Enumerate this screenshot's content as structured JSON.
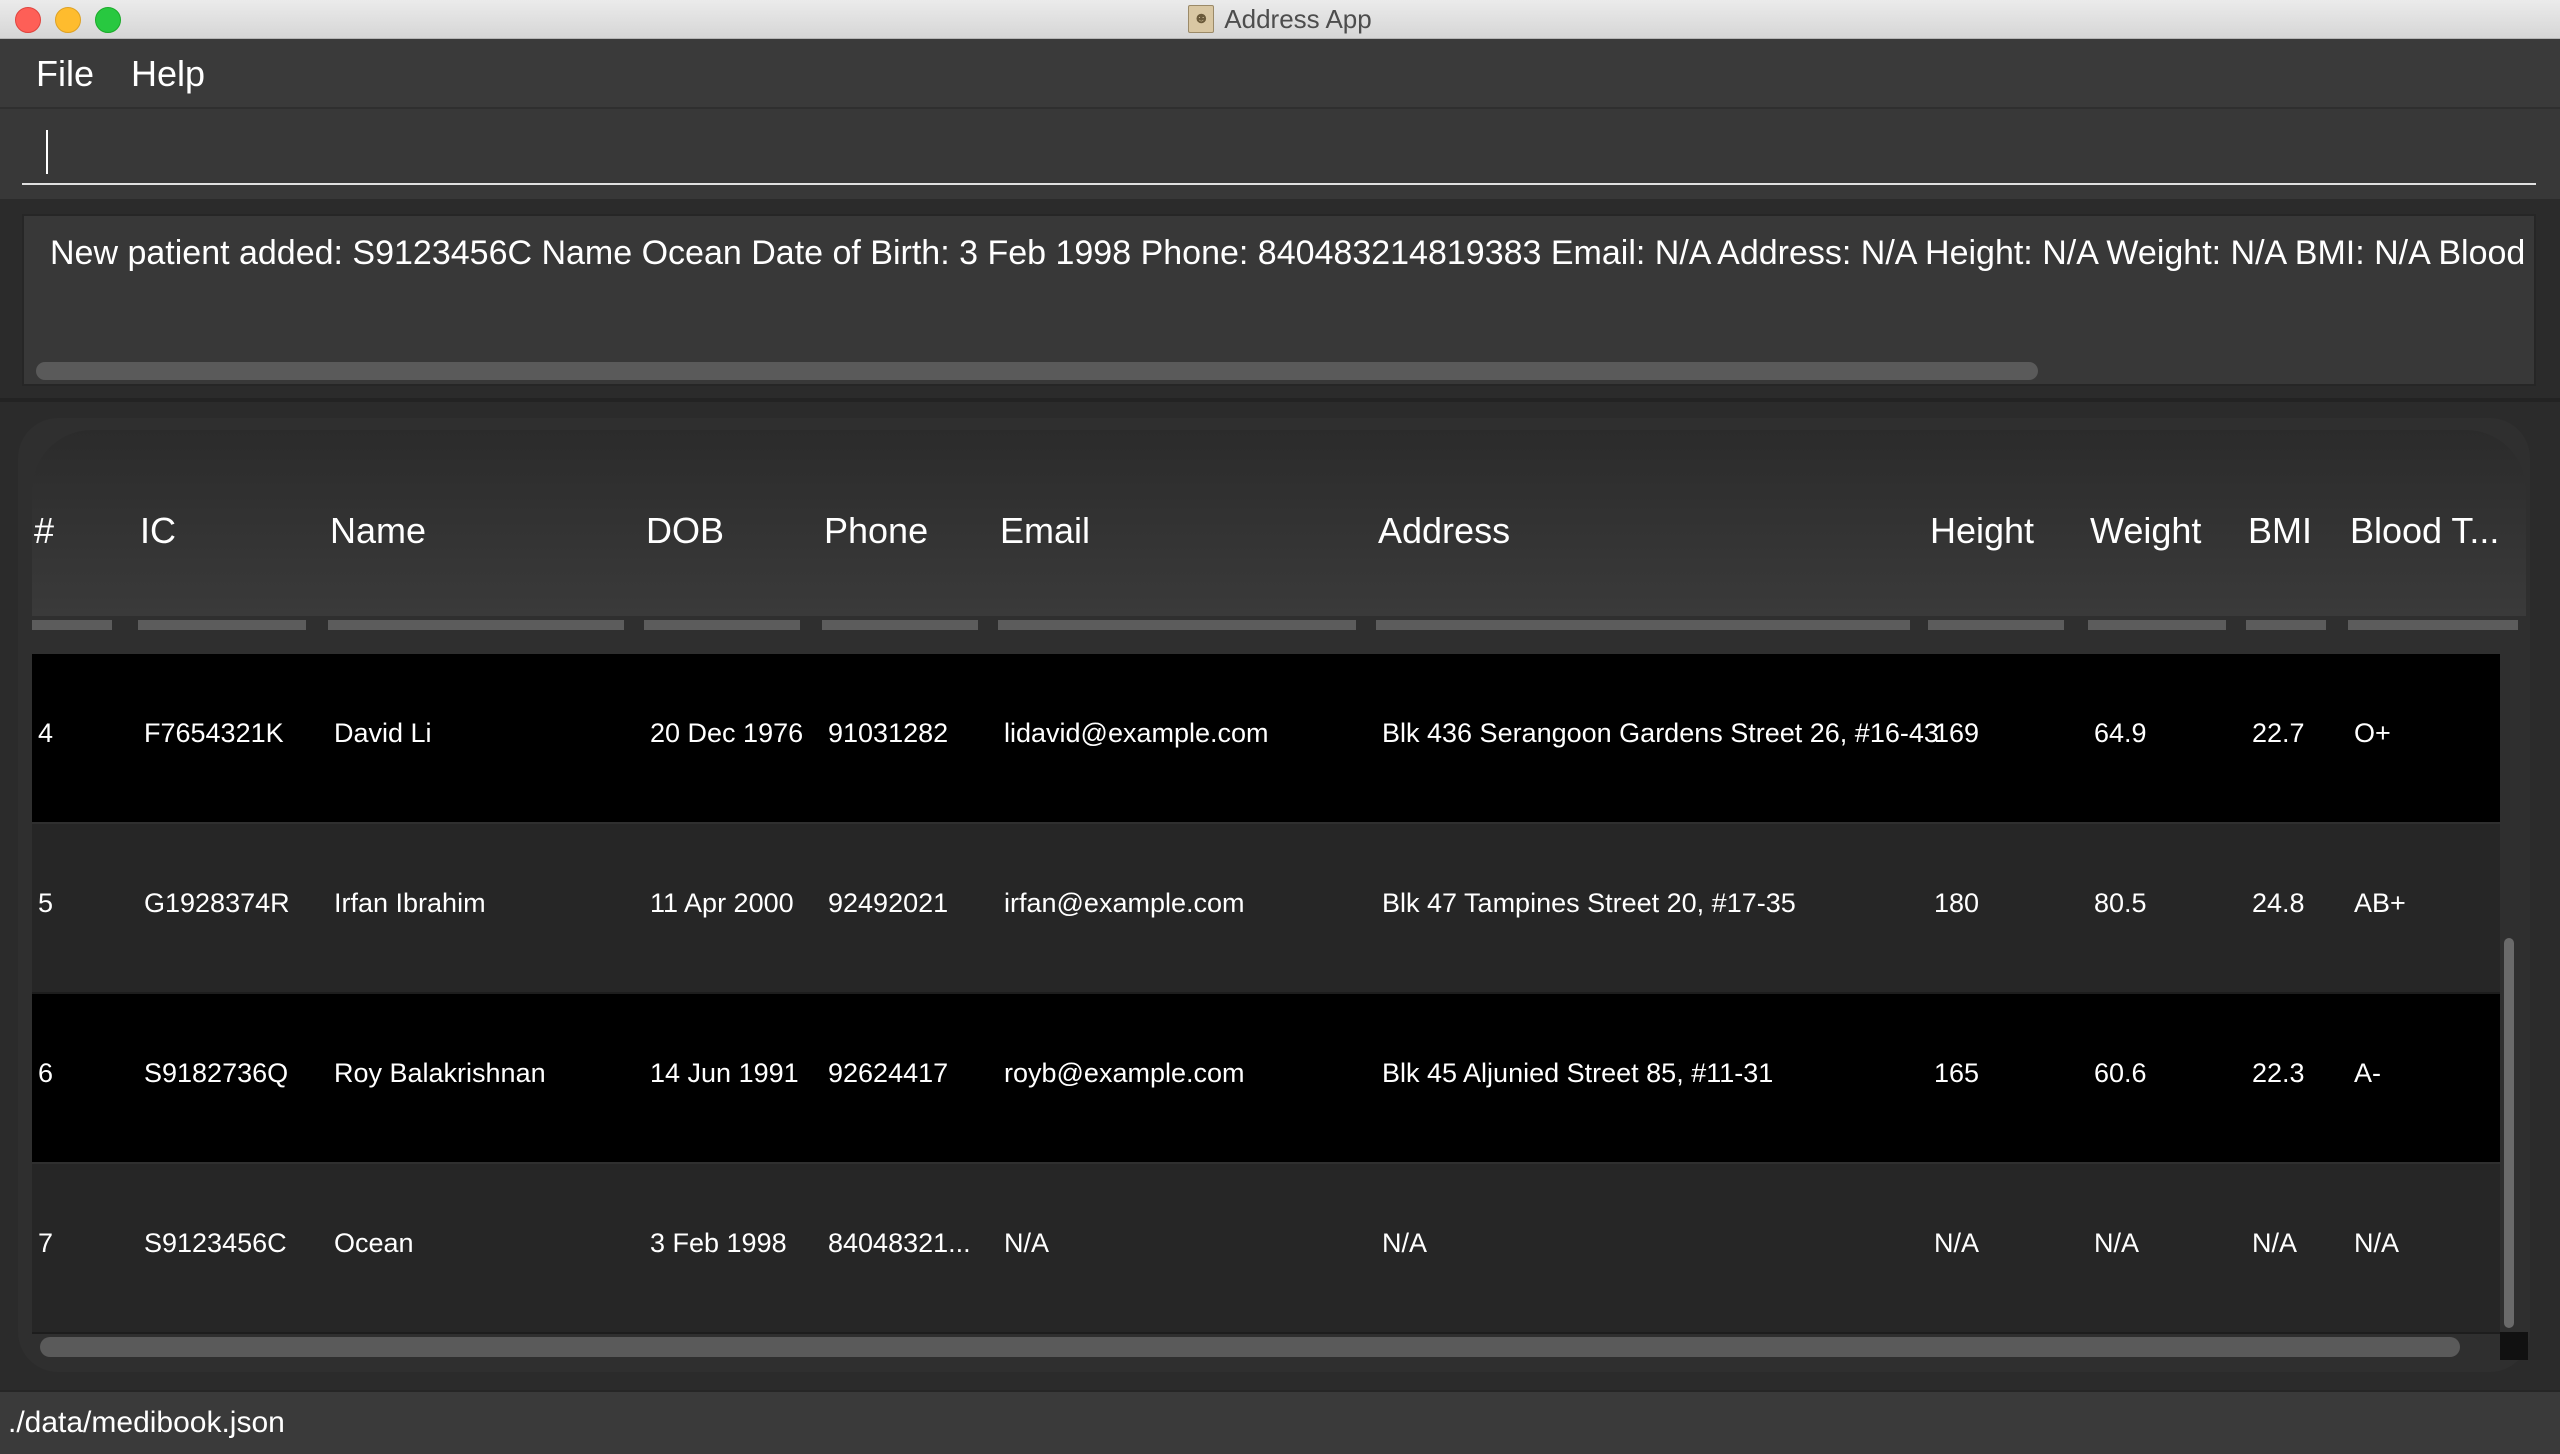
{
  "window": {
    "title": "Address App",
    "icon": "address-book-icon"
  },
  "menu": {
    "file": "File",
    "help": "Help"
  },
  "command": {
    "value": "",
    "placeholder": ""
  },
  "result": {
    "text": "New patient added: S9123456C Name Ocean Date of Birth: 3 Feb 1998 Phone: 840483214819383 Email: N/A Address: N/A Height: N/A Weight: N/A BMI: N/A Blood type:"
  },
  "table": {
    "columns": [
      "#",
      "IC",
      "Name",
      "DOB",
      "Phone",
      "Email",
      "Address",
      "Height",
      "Weight",
      "BMI",
      "Blood T..."
    ],
    "rows": [
      [
        "4",
        "F7654321K",
        "David Li",
        "20 Dec 1976",
        "91031282",
        "lidavid@example.com",
        "Blk 436 Serangoon Gardens Street 26, #16-43",
        "169",
        "64.9",
        "22.7",
        "O+"
      ],
      [
        "5",
        "G1928374R",
        "Irfan Ibrahim",
        "11 Apr 2000",
        "92492021",
        "irfan@example.com",
        "Blk 47 Tampines Street 20, #17-35",
        "180",
        "80.5",
        "24.8",
        "AB+"
      ],
      [
        "6",
        "S9182736Q",
        "Roy Balakrishnan",
        "14 Jun 1991",
        "92624417",
        "royb@example.com",
        "Blk 45 Aljunied Street 85, #11-31",
        "165",
        "60.6",
        "22.3",
        "A-"
      ],
      [
        "7",
        "S9123456C",
        "Ocean",
        "3 Feb 1998",
        "84048321...",
        "N/A",
        "N/A",
        "N/A",
        "N/A",
        "N/A",
        "N/A"
      ]
    ]
  },
  "status": {
    "path": "./data/medibook.json"
  }
}
